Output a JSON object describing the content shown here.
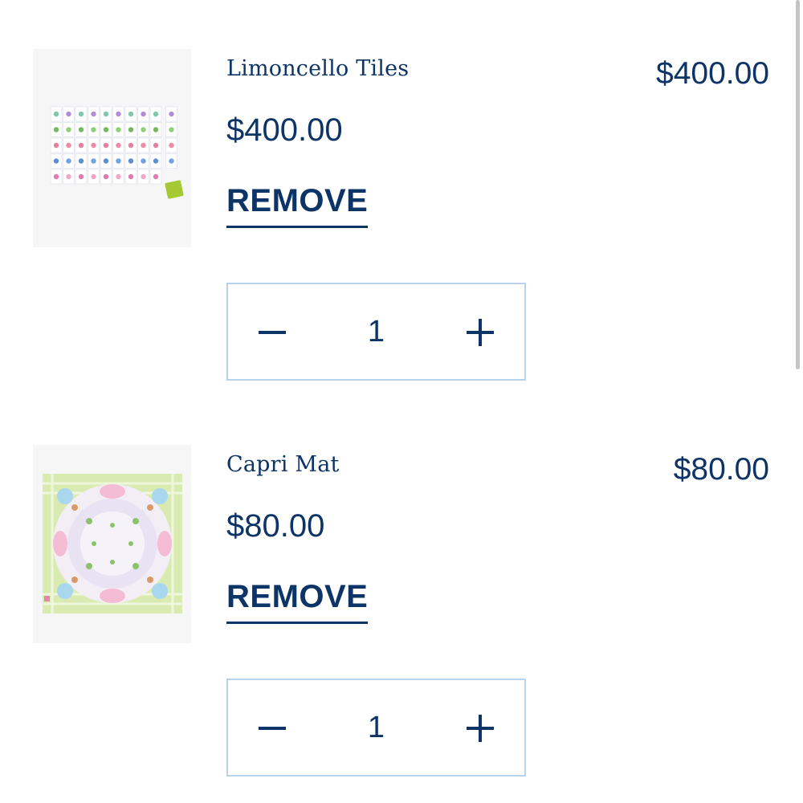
{
  "cart": {
    "items": [
      {
        "title": "Limoncello Tiles",
        "line_total": "$400.00",
        "unit_price": "$400.00",
        "remove_label": "REMOVE",
        "quantity": "1",
        "image_icon": "mahjong-tiles-product-image"
      },
      {
        "title": "Capri Mat",
        "line_total": "$80.00",
        "unit_price": "$80.00",
        "remove_label": "REMOVE",
        "quantity": "1",
        "image_icon": "floral-mat-product-image"
      }
    ]
  },
  "colors": {
    "text": "#0d3466",
    "stepper_border": "#b9d1ea",
    "thumb_background": "#f6f6f6",
    "scrollbar": "#c4c4c4"
  }
}
